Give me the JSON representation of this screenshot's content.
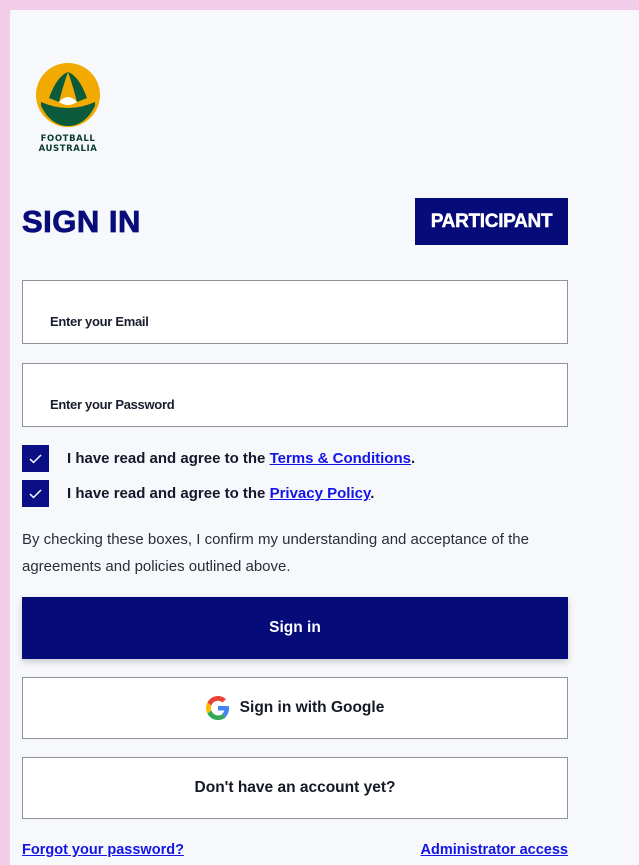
{
  "brand": {
    "logo_icon": "football-australia-logo",
    "logo_line1": "FOOTBALL",
    "logo_line2": "AUSTRALIA",
    "colors": {
      "gold": "#f2a900",
      "green": "#0b5a3c",
      "navy": "#060b7a",
      "link": "#1414e6",
      "page_border": "#f1cdea"
    }
  },
  "header": {
    "title": "SIGN IN",
    "role_badge": "PARTICIPANT"
  },
  "form": {
    "email_label": "Enter your Email",
    "password_label": "Enter your Password",
    "terms": {
      "text": "I have read and agree to the ",
      "link": "Terms & Conditions",
      "suffix": ".",
      "checked": true
    },
    "privacy": {
      "text": "I have read and agree to the ",
      "link": "Privacy Policy",
      "suffix": ".",
      "checked": true
    },
    "consent_note": "By checking these boxes, I confirm my understanding and acceptance of the agreements and policies outlined above."
  },
  "actions": {
    "sign_in": "Sign in",
    "google_icon": "google-g-icon",
    "google": "Sign in with Google",
    "signup": "Don't have an account yet?"
  },
  "footer": {
    "forgot": "Forgot your password?",
    "admin": "Administrator access"
  }
}
